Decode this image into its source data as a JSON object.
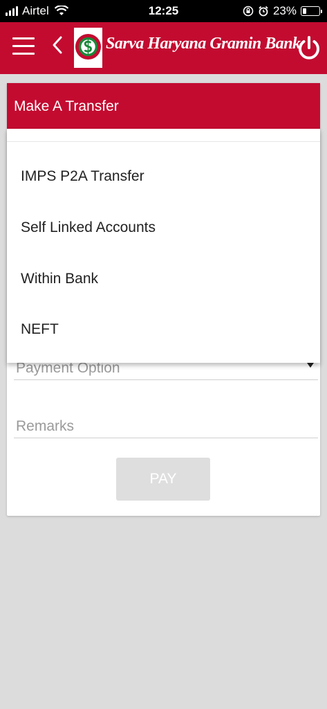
{
  "status_bar": {
    "carrier": "Airtel",
    "time": "12:25",
    "battery": "23%"
  },
  "app_bar": {
    "bank_name": "Sarva Haryana Gramin Bank"
  },
  "card": {
    "title": "Make A Transfer",
    "payment_option_placeholder": "Payment Option",
    "remarks_placeholder": "Remarks",
    "pay_label": "PAY"
  },
  "dropdown": {
    "items": [
      {
        "label": "IMPS P2A Transfer"
      },
      {
        "label": "Self Linked Accounts"
      },
      {
        "label": "Within Bank"
      },
      {
        "label": "NEFT"
      }
    ]
  },
  "colors": {
    "brand": "#c30b30",
    "logo_green": "#1a8a3a"
  }
}
